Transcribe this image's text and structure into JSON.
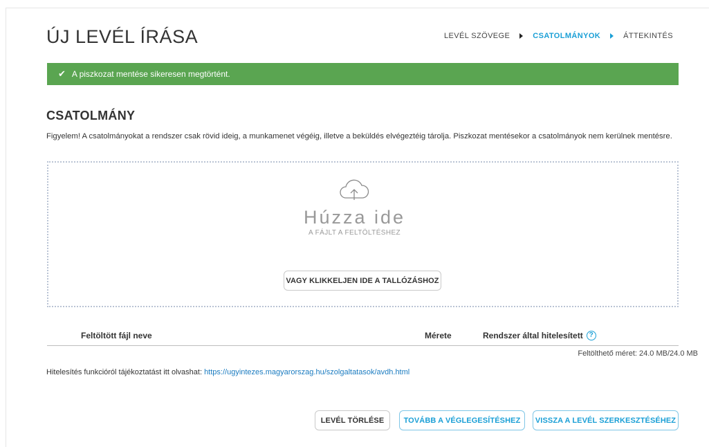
{
  "header": {
    "title": "ÚJ LEVÉL ÍRÁSA",
    "steps": [
      {
        "label": "LEVÉL SZÖVEGE",
        "active": false
      },
      {
        "label": "CSATOLMÁNYOK",
        "active": true
      },
      {
        "label": "ÁTTEKINTÉS",
        "active": false
      }
    ]
  },
  "alert": {
    "icon": "check-icon",
    "text": "A piszkozat mentése sikeresen megtörtént.",
    "color": "#5aa551"
  },
  "attachment": {
    "title": "CSATOLMÁNY",
    "notice": "Figyelem! A csatolmányokat a rendszer csak rövid ideig, a munkamenet végéig, illetve a beküldés elvégeztéig tárolja. Piszkozat mentésekor a csatolmányok nem kerülnek mentésre.",
    "dropzone": {
      "icon": "cloud-upload-icon",
      "main": "Húzza ide",
      "sub": "A FÁJLT A FELTÖLTÉSHEZ",
      "browse_label": "VAGY KLIKKELJEN IDE A TALLÓZÁSHOZ"
    },
    "table": {
      "columns": [
        "Feltöltött fájl neve",
        "Mérete",
        "Rendszer által hitelesített"
      ],
      "help_icon": "question-circle-icon",
      "rows": []
    },
    "quota_label": "Feltölthető méret:",
    "quota_value": "24.0 MB/24.0 MB"
  },
  "info": {
    "text": "Hitelesítés funkcióról tájékoztatást itt olvashat:",
    "link": "https://ugyintezes.magyarorszag.hu/szolgaltatasok/avdh.html"
  },
  "actions": {
    "delete_label": "LEVÉL TÖRLÉSE",
    "finalize_label": "TOVÁBB A VÉGLEGESÍTÉSHEZ",
    "back_label": "VISSZA A LEVÉL SZERKESZTÉSÉHEZ"
  },
  "colors": {
    "accent": "#1a9fd6",
    "success": "#5aa551"
  }
}
